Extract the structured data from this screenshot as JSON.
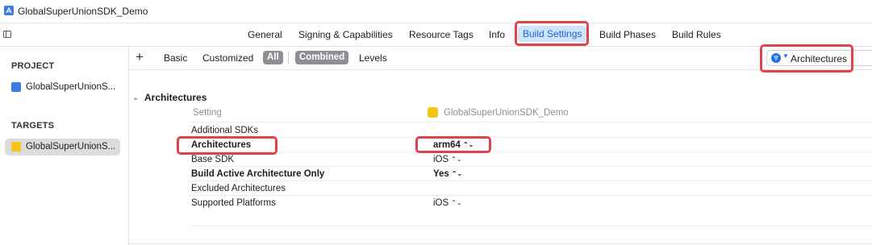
{
  "window": {
    "title": "GlobalSuperUnionSDK_Demo"
  },
  "tabs": [
    {
      "label": "General"
    },
    {
      "label": "Signing & Capabilities"
    },
    {
      "label": "Resource Tags"
    },
    {
      "label": "Info"
    },
    {
      "label": "Build Settings"
    },
    {
      "label": "Build Phases"
    },
    {
      "label": "Build Rules"
    }
  ],
  "sidebar": {
    "project_header": "PROJECT",
    "project_item": "GlobalSuperUnionS...",
    "targets_header": "TARGETS",
    "target_item": "GlobalSuperUnionS..."
  },
  "toolbar": {
    "add_label": "+",
    "basic_label": "Basic",
    "customized_label": "Customized",
    "all_label": "All",
    "combined_label": "Combined",
    "levels_label": "Levels",
    "search_value": "Architectures"
  },
  "content": {
    "group_title": "Architectures",
    "column_setting": "Setting",
    "column_target": "GlobalSuperUnionSDK_Demo",
    "rows": [
      {
        "name": "Additional SDKs",
        "value": ""
      },
      {
        "name": "Architectures",
        "value": "arm64"
      },
      {
        "name": "Base SDK",
        "value": "iOS"
      },
      {
        "name": "Build Active Architecture Only",
        "value": "Yes"
      },
      {
        "name": "Excluded Architectures",
        "value": ""
      },
      {
        "name": "Supported Platforms",
        "value": "iOS"
      }
    ],
    "stepper_glyph": "⌃⌄"
  },
  "colors": {
    "highlight": "#e0444b",
    "accent": "#1a66d2",
    "selected_tab_bg": "#cfe3fb"
  }
}
